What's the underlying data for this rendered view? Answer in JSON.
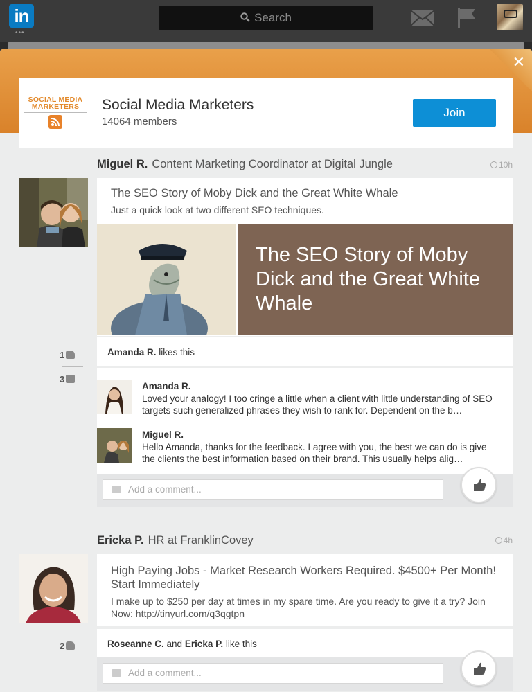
{
  "topbar": {
    "logo_text": "in",
    "search_placeholder": "Search",
    "icons": [
      "mail-icon",
      "flag-icon",
      "search-icon"
    ]
  },
  "group": {
    "logo_line1": "SOCIAL MEDIA",
    "logo_line2": "MARKETERS",
    "name": "Social Media Marketers",
    "members": "14064 members",
    "join_label": "Join",
    "colors": {
      "band": "#e39a44",
      "join": "#0d8fd6",
      "article_bg": "#7e6453"
    }
  },
  "posts": [
    {
      "author": "Miguel R.",
      "role": "Content Marketing Coordinator at Digital Jungle",
      "time": "10h",
      "title": "The SEO Story of Moby Dick and the Great White Whale",
      "desc": "Just a quick look at two different SEO techniques.",
      "image_text": "The SEO Story of Moby Dick and the Great White Whale",
      "like_count": "1",
      "comment_count": "3",
      "likes_name": "Amanda R.",
      "likes_suffix": " likes this",
      "comments": [
        {
          "name": "Amanda R.",
          "text": "Loved your analogy! I too cringe a little when a client with little understanding of SEO targets such generalized phrases they wish to rank for. Dependent on the b…"
        },
        {
          "name": "Miguel R.",
          "text": "Hello Amanda, thanks for the feedback. I agree with you, the best we can do is give the clients the best information based on their brand. This usually helps alig…"
        }
      ],
      "comment_placeholder": "Add a comment..."
    },
    {
      "author": "Ericka P.",
      "role": "HR at FranklinCovey",
      "time": "4h",
      "title": "High Paying Jobs - Market Research Workers Required. $4500+ Per Month! Start Immediately",
      "desc": "I make up to $250 per day at times in my spare time. Are you ready to give it a try? Join Now: http://tinyurl.com/q3qgtpn",
      "like_count": "2",
      "likes_name1": "Roseanne C.",
      "likes_and": " and ",
      "likes_name2": "Ericka P.",
      "likes_suffix": " like this",
      "comment_placeholder": "Add a comment..."
    }
  ]
}
